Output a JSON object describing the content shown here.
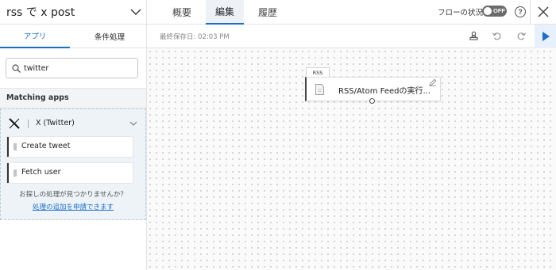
{
  "header": {
    "flow_title": "rss で x post",
    "tabs": [
      {
        "label": "概要",
        "active": false
      },
      {
        "label": "編集",
        "active": true
      },
      {
        "label": "履歴",
        "active": false
      }
    ],
    "flow_status_label": "フローの状況",
    "toggle_state": "OFF",
    "help_label": "?"
  },
  "toolbar": {
    "sidebar_tabs": [
      {
        "label": "アプリ",
        "active": true
      },
      {
        "label": "条件処理",
        "active": false
      }
    ],
    "last_saved": "最終保存日: 02:03 PM"
  },
  "sidebar": {
    "search": {
      "value": "twitter",
      "placeholder": ""
    },
    "matching_header": "Matching apps",
    "app": {
      "name": "X (Twitter)"
    },
    "actions": [
      {
        "label": "Create tweet"
      },
      {
        "label": "Fetch user"
      }
    ],
    "not_found_text": "お探しの処理が見つかりませんか？",
    "request_link": "処理の追加を申請できます"
  },
  "canvas": {
    "node": {
      "tag": "RSS",
      "label": "RSS/Atom Feedの実行..."
    }
  },
  "colors": {
    "accent": "#1a6fc9",
    "toggle_off": "#6b6b6b",
    "panel_bg": "#eef3f8"
  },
  "icons": [
    "chevron-down-icon",
    "help-icon",
    "close-icon",
    "stamp-icon",
    "undo-icon",
    "redo-icon",
    "play-icon",
    "search-icon",
    "x-logo-icon",
    "grip-icon",
    "document-icon",
    "edit-icon"
  ]
}
